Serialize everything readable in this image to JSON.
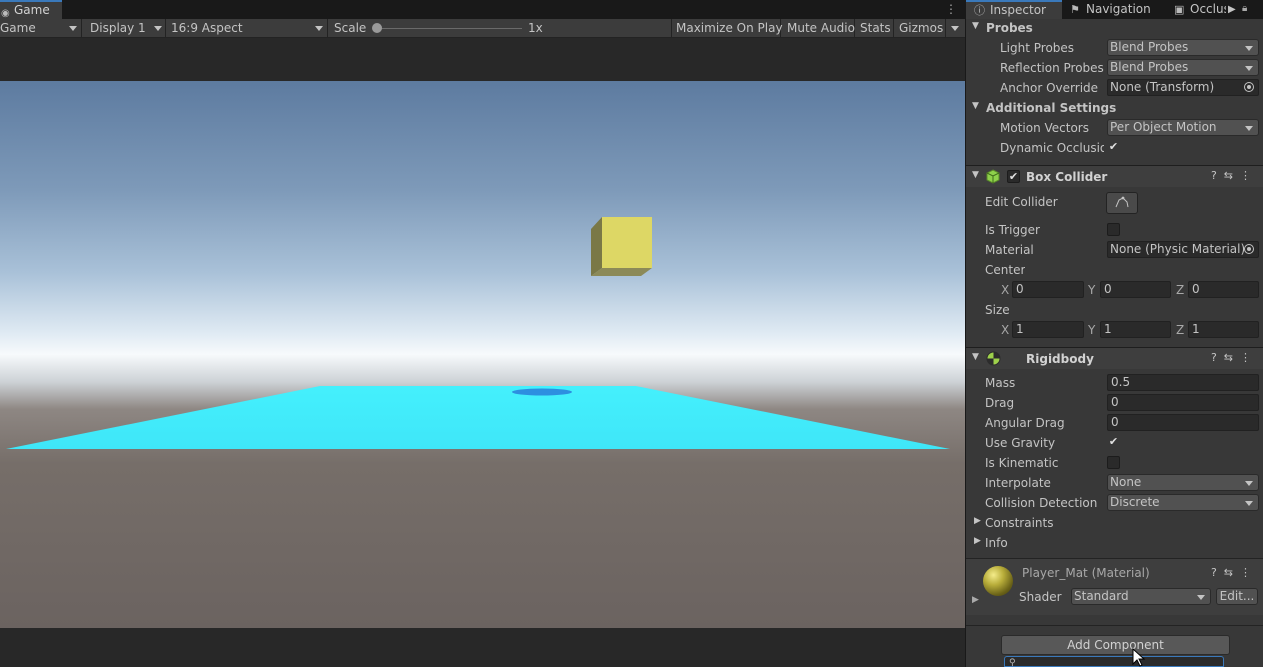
{
  "game": {
    "tab_label": "Game",
    "menu_dots": "⋮",
    "toolbar": {
      "mode": "Game",
      "display": "Display 1",
      "aspect": "16:9 Aspect",
      "scale_label": "Scale",
      "scale_value": "1x",
      "maximize_on_play": "Maximize On Play",
      "mute_audio": "Mute Audio",
      "stats": "Stats",
      "gizmos": "Gizmos"
    }
  },
  "inspector": {
    "tabs": [
      {
        "label": "Inspector",
        "icon": "info-icon"
      },
      {
        "label": "Navigation",
        "icon": "navigation-icon"
      },
      {
        "label": "Occlus",
        "icon": "occlusion-icon"
      }
    ],
    "probes": {
      "header": "Probes",
      "light_probes_label": "Light Probes",
      "light_probes_value": "Blend Probes",
      "reflection_probes_label": "Reflection Probes",
      "reflection_probes_value": "Blend Probes",
      "anchor_override_label": "Anchor Override",
      "anchor_override_value": "None (Transform)"
    },
    "additional": {
      "header": "Additional Settings",
      "motion_vectors_label": "Motion Vectors",
      "motion_vectors_value": "Per Object Motion",
      "dynamic_occlusion_label": "Dynamic Occlusion",
      "dynamic_occlusion_checked": "✔"
    },
    "box_collider": {
      "title": "Box Collider",
      "enabled_mark": "✔",
      "edit_collider_label": "Edit Collider",
      "is_trigger_label": "Is Trigger",
      "material_label": "Material",
      "material_value": "None (Physic Material)",
      "center_label": "Center",
      "center": {
        "x": "0",
        "y": "0",
        "z": "0"
      },
      "size_label": "Size",
      "size": {
        "x": "1",
        "y": "1",
        "z": "1"
      },
      "axis_x": "X",
      "axis_y": "Y",
      "axis_z": "Z"
    },
    "rigidbody": {
      "title": "Rigidbody",
      "mass_label": "Mass",
      "mass_value": "0.5",
      "drag_label": "Drag",
      "drag_value": "0",
      "angular_drag_label": "Angular Drag",
      "angular_drag_value": "0",
      "use_gravity_label": "Use Gravity",
      "use_gravity_checked": "✔",
      "is_kinematic_label": "Is Kinematic",
      "interpolate_label": "Interpolate",
      "interpolate_value": "None",
      "collision_detection_label": "Collision Detection",
      "collision_detection_value": "Discrete",
      "constraints_label": "Constraints",
      "info_label": "Info"
    },
    "material": {
      "name": "Player_Mat (Material)",
      "shader_label": "Shader",
      "shader_value": "Standard",
      "edit_label": "Edit..."
    },
    "add_component_label": "Add Component"
  },
  "colors": {
    "accent": "#3a79bb",
    "box_collider_icon": "#8ed14b",
    "rigidbody_icon": "#9ed14b",
    "cube": "#ddd765",
    "plane": "#45f4fe"
  }
}
